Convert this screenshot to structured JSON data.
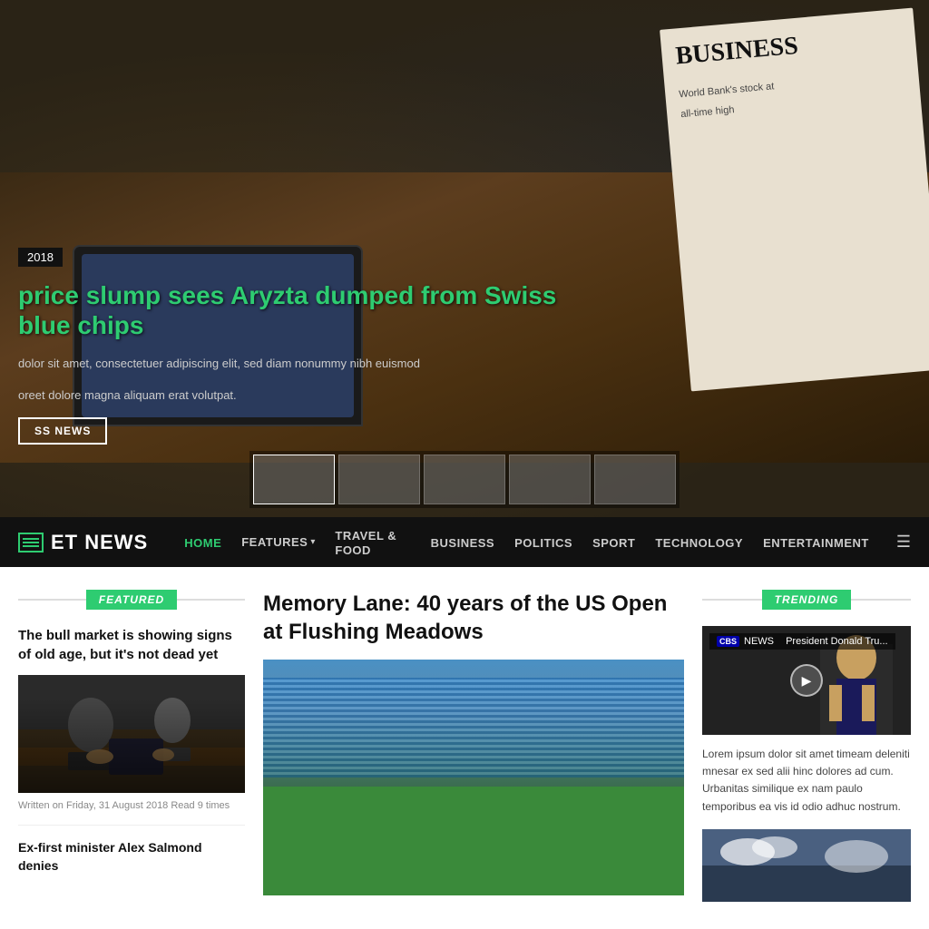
{
  "hero": {
    "date": "2018",
    "title": "price slump sees Aryzta dumped from Swiss blue chips",
    "excerpt_line1": "dolor sit amet, consectetuer adipiscing elit, sed diam nonummy nibh euismod",
    "excerpt_line2": "oreet dolore magna aliquam erat volutpat.",
    "button_label": "SS NEWS",
    "newspaper_headline": "BUSINESS",
    "newspaper_sub1": "World Bank's stock at",
    "newspaper_sub2": "all-time high"
  },
  "navbar": {
    "logo_text": "ET NEWS",
    "nav_items": [
      {
        "label": "HOME",
        "active": true
      },
      {
        "label": "FEATURES",
        "has_dropdown": true
      },
      {
        "label": "TRAVEL & FOOD",
        "active": false
      },
      {
        "label": "BUSINESS",
        "active": false
      },
      {
        "label": "POLITICS",
        "active": false
      },
      {
        "label": "SPORT",
        "active": false
      },
      {
        "label": "TECHNOLOGY",
        "active": false
      },
      {
        "label": "ENTERTAINMENT",
        "active": false
      }
    ]
  },
  "featured": {
    "section_label": "FEATURED",
    "article1": {
      "title": "The bull market is showing signs of old age, but it's not dead yet",
      "meta": "Written on Friday, 31 August 2018  Read 9 times"
    },
    "article2": {
      "title": "Ex-first minister Alex Salmond denies"
    }
  },
  "main_article": {
    "title": "Memory Lane: 40 years of the US Open at Flushing Meadows"
  },
  "trending": {
    "section_label": "TRENDING",
    "video_channel": "CBS NEWS",
    "video_title": "President Donald Tru...",
    "video_text": "Lorem ipsum dolor sit amet timeam deleniti mnesar ex sed alii hinc dolores ad cum. Urbanitas similique ex nam paulo temporibus ea vis id odio adhuc nostrum."
  }
}
